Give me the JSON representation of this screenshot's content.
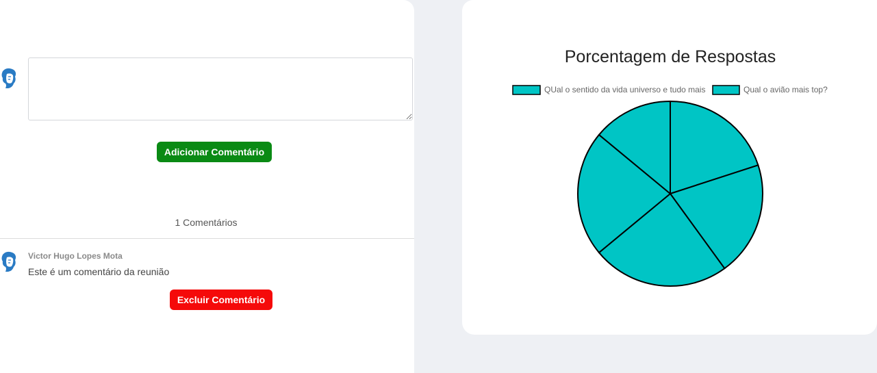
{
  "comment_form": {
    "textarea_value": "",
    "add_button_label": "Adicionar Comentário"
  },
  "comments": {
    "count_label": "1 Comentários",
    "items": [
      {
        "author": "Victor Hugo Lopes Mota",
        "text": "Este é um comentário da reunião",
        "delete_button_label": "Excluir Comentário"
      }
    ]
  },
  "colors": {
    "add_button": "#0a8a14",
    "delete_button": "#f50a0a",
    "pie_fill": "#00c5c5",
    "pie_stroke": "#000000"
  },
  "chart_data": {
    "type": "pie",
    "title": "Porcentagem de Respostas",
    "legend_position": "top",
    "legend": [
      "QUal o sentido da vida universo e tudo mais",
      "Qual o avião mais top?"
    ],
    "values": [
      20,
      20,
      24,
      22,
      14
    ]
  }
}
